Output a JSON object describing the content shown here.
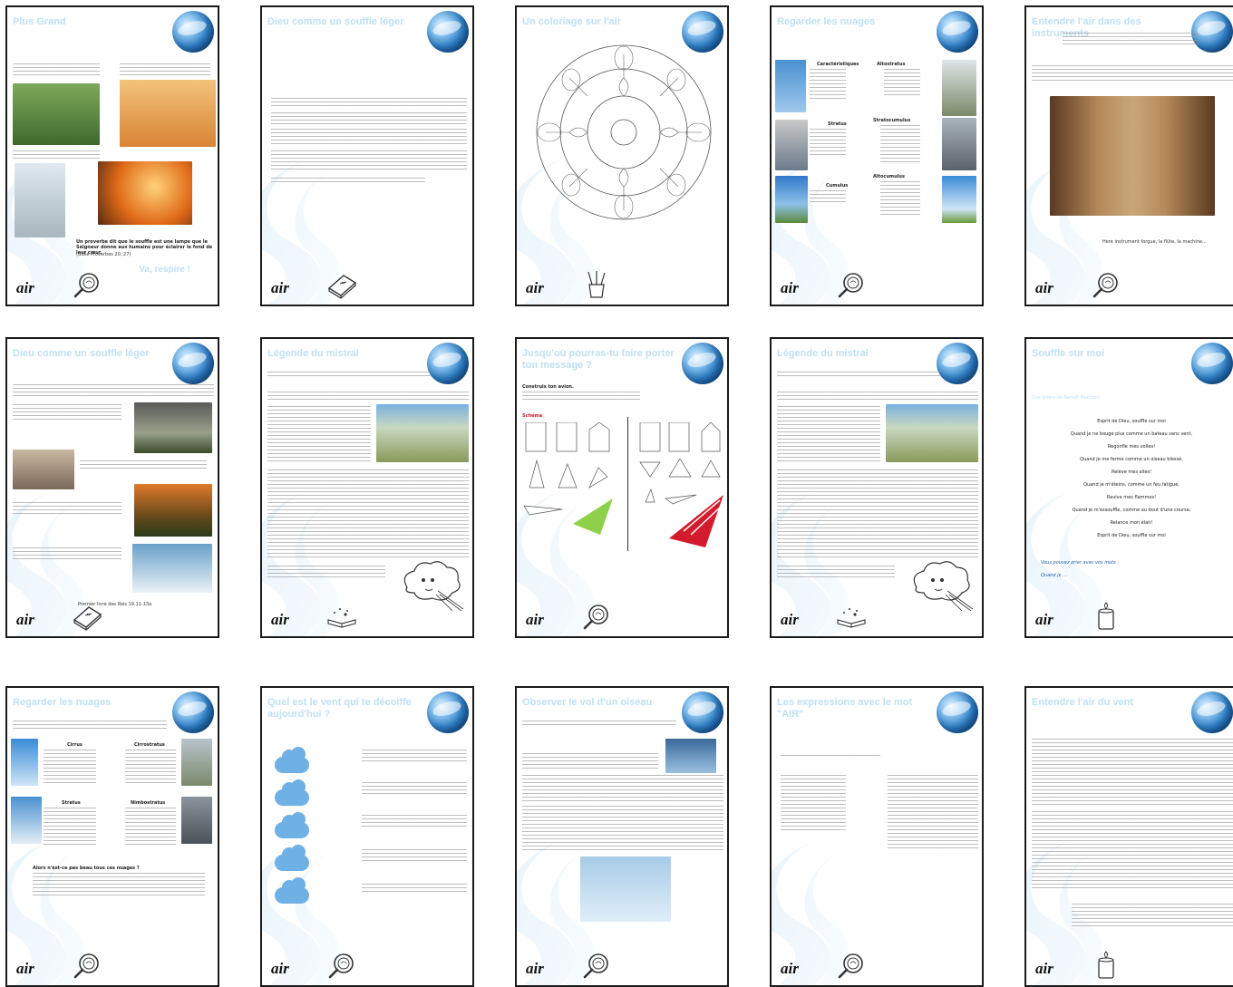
{
  "brand": {
    "logo_text": "air",
    "accent": "#bfe0f5",
    "globe_color": "#2f7fc6"
  },
  "pages": {
    "p1": {
      "title": "Plus Grand",
      "quote": "Un proverbe dit que le souffle est une lampe que le Seigneur donne aux humains pour éclairer le fond de leur cœur.",
      "ref": "(Bible Proverbes 20, 27)",
      "cta": "Va, respire !"
    },
    "p2": {
      "title": "Dieu comme un souffle léger"
    },
    "p3": {
      "title": "Un coloriage sur l'air"
    },
    "p4": {
      "title": "Regarder les nuages",
      "labels": [
        "Caractéristiques",
        "Altostratus",
        "Stratus",
        "Stratocumulus",
        "Cumulus",
        "Altocumulus"
      ]
    },
    "p5": {
      "title": "Entendre l'air dans des instruments",
      "caption": "Here instrument forgue, la flûte, la machine..."
    },
    "p6": {
      "title": "Dieu comme un souffle léger",
      "footnote": "Premier livre des Rois 19,11-13a"
    },
    "p7": {
      "title": "Légende du mistral"
    },
    "p8": {
      "title": "Jusqu'où pourras-tu faire porter ton message ?",
      "intro": "Construis ton avion.",
      "tag": "Schéma"
    },
    "p9": {
      "title": "Légende du mistral"
    },
    "p10": {
      "title": "Souffle sur moi",
      "subtitle": "Une prière de Benoît Marchon",
      "poem": [
        "Esprit de Dieu, souffle sur moi",
        "Quand je ne bouge plus comme un bateau sans vent,",
        "Regonfle mes voiles!",
        "Quand je me ferme comme un oiseau blessé,",
        "Relève mes ailes!",
        "Quand je m'éteins, comme un feu fatigué,",
        "Ravive mes flammes!",
        "Quand je m'essouffle, comme au bout d'une course,",
        "Relance mon élan!",
        "Esprit de Dieu, souffle sur moi"
      ],
      "invite": "Vous pouvez prier avec vos mots :",
      "start": "Quand je ..."
    },
    "p11": {
      "title": "Regarder les nuages",
      "labels": [
        "Cirrus",
        "Cirrostratus",
        "Stratus",
        "Nimbostratus"
      ],
      "q": "Alors n'est-ce pas beau tous ces nuages ?"
    },
    "p12": {
      "title": "Quel est le vent qui te décoiffe aujourd'hui ?"
    },
    "p13": {
      "title": "Observer le vol d'un oiseau"
    },
    "p14": {
      "title": "Les expressions avec le mot \"AIR\""
    },
    "p15": {
      "title": "Entendre l'air du vent"
    }
  }
}
